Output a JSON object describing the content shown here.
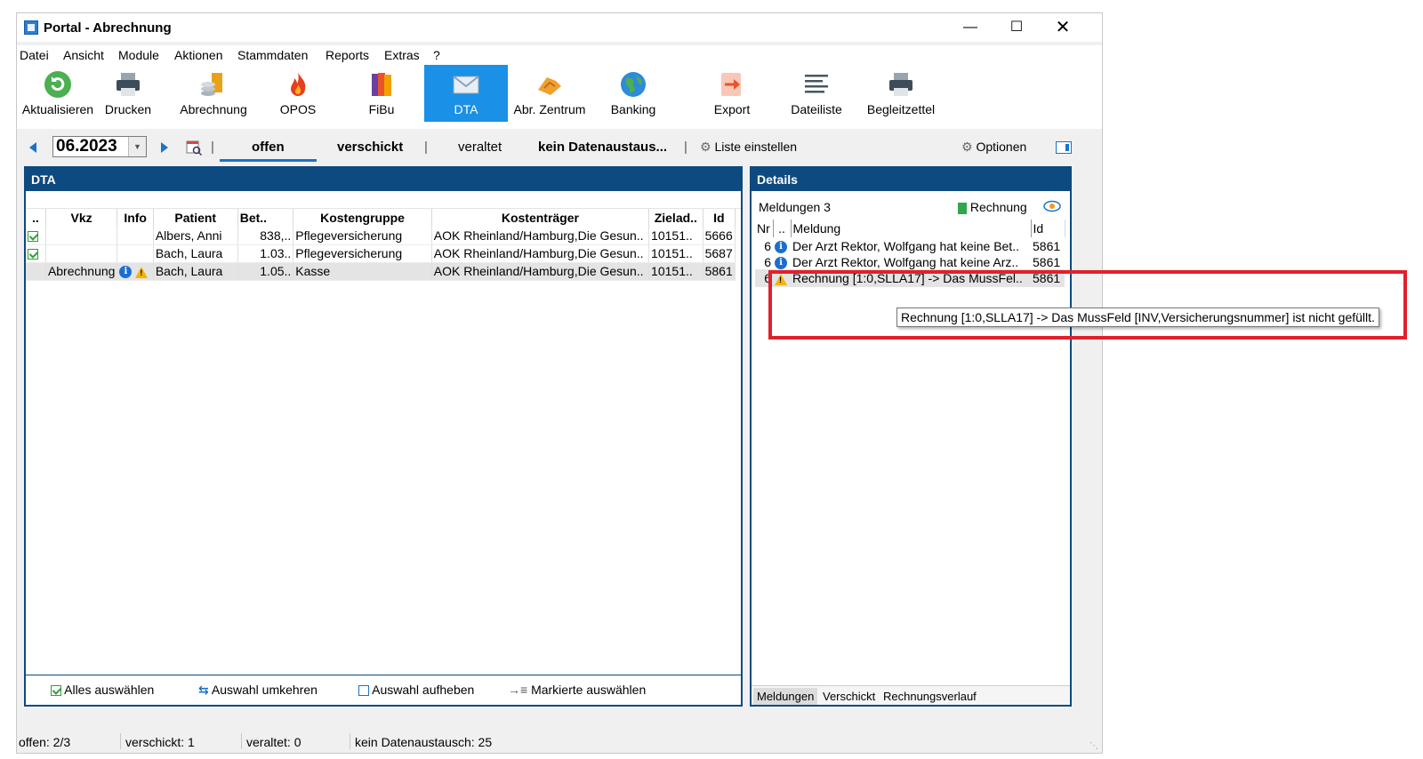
{
  "window": {
    "title": "Portal - Abrechnung"
  },
  "menu": [
    "Datei",
    "Ansicht",
    "Module",
    "Aktionen",
    "Stammdaten",
    "Reports",
    "Extras",
    "?"
  ],
  "toolbar": [
    {
      "label": "Aktualisieren",
      "icon": "refresh-icon"
    },
    {
      "label": "Drucken",
      "icon": "printer-icon"
    },
    {
      "label": "Abrechnung",
      "icon": "coins-icon"
    },
    {
      "label": "OPOS",
      "icon": "flame-icon"
    },
    {
      "label": "FiBu",
      "icon": "books-icon"
    },
    {
      "label": "DTA",
      "icon": "envelope-icon",
      "active": true
    },
    {
      "label": "Abr. Zentrum",
      "icon": "handshake-icon"
    },
    {
      "label": "Banking",
      "icon": "globe-icon"
    },
    {
      "label": "Export",
      "icon": "export-icon"
    },
    {
      "label": "Dateiliste",
      "icon": "list-icon"
    },
    {
      "label": "Begleitzettel",
      "icon": "printer-icon"
    }
  ],
  "nav": {
    "period": "06.2023",
    "tabs": [
      "offen",
      "verschickt",
      "veraltet",
      "kein Datenaustaus..."
    ],
    "active_tab": "offen",
    "liste_einstellen": "Liste einstellen",
    "optionen": "Optionen"
  },
  "dta": {
    "title": "DTA",
    "columns": [
      "..",
      "Vkz",
      "Info",
      "Patient",
      "Bet..",
      "Kostengruppe",
      "Kostenträger",
      "Zielad..",
      "Id"
    ],
    "rows": [
      {
        "check": true,
        "vkz": "",
        "info": "",
        "patient": "Albers, Anni",
        "betrag": "838,..",
        "kostengruppe": "Pflegeversicherung",
        "kostentraeger": "AOK Rheinland/Hamburg,Die Gesun..",
        "zielad": "10151..",
        "id": "5666"
      },
      {
        "check": true,
        "vkz": "",
        "info": "",
        "patient": "Bach, Laura",
        "betrag": "1.03..",
        "kostengruppe": "Pflegeversicherung",
        "kostentraeger": "AOK Rheinland/Hamburg,Die Gesun..",
        "zielad": "10151..",
        "id": "5687"
      },
      {
        "check": false,
        "vkz": "Abrechnung",
        "info": "info+warn",
        "patient": "Bach, Laura",
        "betrag": "1.05..",
        "kostengruppe": "Kasse",
        "kostentraeger": "AOK Rheinland/Hamburg,Die Gesun..",
        "zielad": "10151..",
        "id": "5861",
        "selected": true
      }
    ],
    "footer": {
      "select_all": "Alles auswählen",
      "invert": "Auswahl umkehren",
      "clear": "Auswahl aufheben",
      "select_marked": "Markierte auswählen"
    }
  },
  "details": {
    "title": "Details",
    "meldungen_label": "Meldungen 3",
    "rechnung_label": "Rechnung",
    "columns": [
      "Nr",
      "..",
      "Meldung",
      "Id"
    ],
    "rows": [
      {
        "nr": "6",
        "type": "info",
        "meldung": "Der Arzt Rektor, Wolfgang hat keine Bet..",
        "id": "5861"
      },
      {
        "nr": "6",
        "type": "info",
        "meldung": "Der Arzt Rektor, Wolfgang hat keine Arz..",
        "id": "5861"
      },
      {
        "nr": "6",
        "type": "warn",
        "meldung": "Rechnung [1:0,SLLA17] -> Das MussFel..",
        "id": "5861"
      }
    ],
    "tooltip": "Rechnung [1:0,SLLA17] -> Das MussFeld [INV,Versicherungsnummer] ist nicht gefüllt.",
    "bottom_tabs": [
      "Meldungen",
      "Verschickt",
      "Rechnungsverlauf"
    ]
  },
  "status": {
    "offen": "offen: 2/3",
    "verschickt": "verschickt: 1",
    "veraltet": "veraltet: 0",
    "kein": "kein Datenaustausch: 25"
  },
  "colors": {
    "panel_header": "#0d4a7f",
    "active_tool": "#1a90e6",
    "highlight": "#e0212b"
  }
}
